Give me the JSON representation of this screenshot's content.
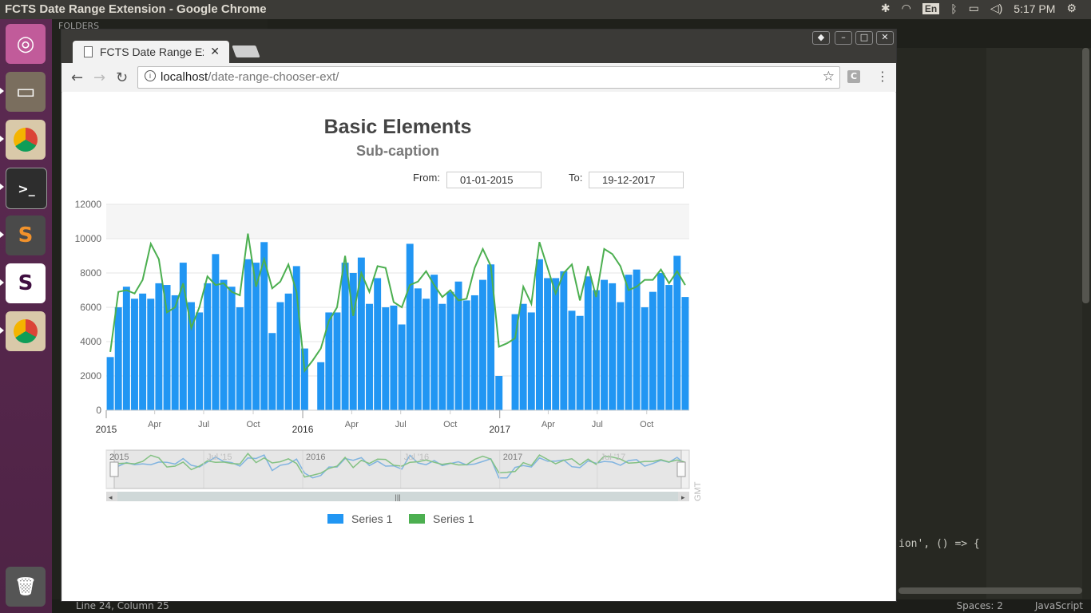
{
  "os": {
    "window_title": "FCTS Date Range Extension - Google Chrome",
    "clock": "5:17 PM",
    "lang": "En"
  },
  "editor": {
    "sidebar_header": "FOLDERS",
    "code_line": "ion', () => {",
    "status_left": "Line 24, Column 25",
    "status_spaces": "Spaces: 2",
    "status_syntax": "JavaScript"
  },
  "browser": {
    "tab_title": "FCTS Date Range Ex",
    "url_host": "localhost",
    "url_path": "/date-range-chooser-ext/",
    "extension_label": "C"
  },
  "page": {
    "from_label": "From:",
    "from_value": "01-01-2015",
    "to_label": "To:",
    "to_value": "19-12-2017",
    "gmt": "GMT"
  },
  "chart_data": {
    "type": "bar",
    "title": "Basic Elements",
    "subtitle": "Sub-caption",
    "ylim": [
      0,
      12000
    ],
    "yticks": [
      0,
      2000,
      4000,
      6000,
      8000,
      10000,
      12000
    ],
    "x_start": "2015-01-01",
    "x_end": "2017-12-19",
    "xticks_major": [
      "2015",
      "2016",
      "2017"
    ],
    "xticks_minor": [
      "Apr",
      "Jul",
      "Oct",
      "Apr",
      "Jul",
      "Oct",
      "Apr",
      "Jul",
      "Oct"
    ],
    "navigator_labels": [
      "2015",
      "Jul '15",
      "2016",
      "Jul '16",
      "2017",
      "Jul '17"
    ],
    "legend": [
      {
        "name": "Series 1",
        "color": "#2196f3"
      },
      {
        "name": "Series 1",
        "color": "#4caf50"
      }
    ],
    "series": [
      {
        "name": "Series 1",
        "type": "column",
        "color": "#2196f3",
        "values": [
          3100,
          6000,
          7200,
          6500,
          6800,
          6500,
          7400,
          7300,
          6700,
          8600,
          6300,
          5700,
          7400,
          9100,
          7600,
          7200,
          6000,
          8800,
          8600,
          9800,
          4500,
          6300,
          6800,
          8400,
          3600,
          0,
          2800,
          5700,
          5700,
          8600,
          8000,
          8900,
          6200,
          7700,
          6000,
          6100,
          5000,
          9700,
          7100,
          6500,
          7900,
          6200,
          6900,
          7500,
          6400,
          6700,
          7600,
          8500,
          2000,
          0,
          5600,
          6200,
          5700,
          8800,
          7700,
          7700,
          8100,
          5800,
          5500,
          7800,
          7000,
          7600,
          7400,
          6300,
          7900,
          8200,
          6000,
          6900,
          8000,
          7300,
          9000,
          6600
        ]
      },
      {
        "name": "Series 1",
        "type": "line",
        "color": "#4caf50",
        "values": [
          3400,
          6900,
          7000,
          6800,
          7600,
          9700,
          8800,
          5700,
          6000,
          7400,
          4800,
          6000,
          7800,
          7300,
          7400,
          6900,
          6700,
          10300,
          7200,
          8800,
          7100,
          7500,
          8500,
          6900,
          2300,
          2900,
          3600,
          5200,
          6000,
          9000,
          5500,
          8000,
          6900,
          8400,
          8300,
          6300,
          6000,
          7300,
          7500,
          8100,
          7300,
          6600,
          7000,
          6400,
          6500,
          8300,
          9400,
          8400,
          3700,
          3900,
          4200,
          7200,
          6200,
          9800,
          8300,
          6800,
          8000,
          8500,
          6400,
          8400,
          6600,
          9400,
          9100,
          8400,
          7000,
          7200,
          7600,
          7600,
          8200,
          7400,
          8100,
          7300
        ]
      }
    ]
  }
}
